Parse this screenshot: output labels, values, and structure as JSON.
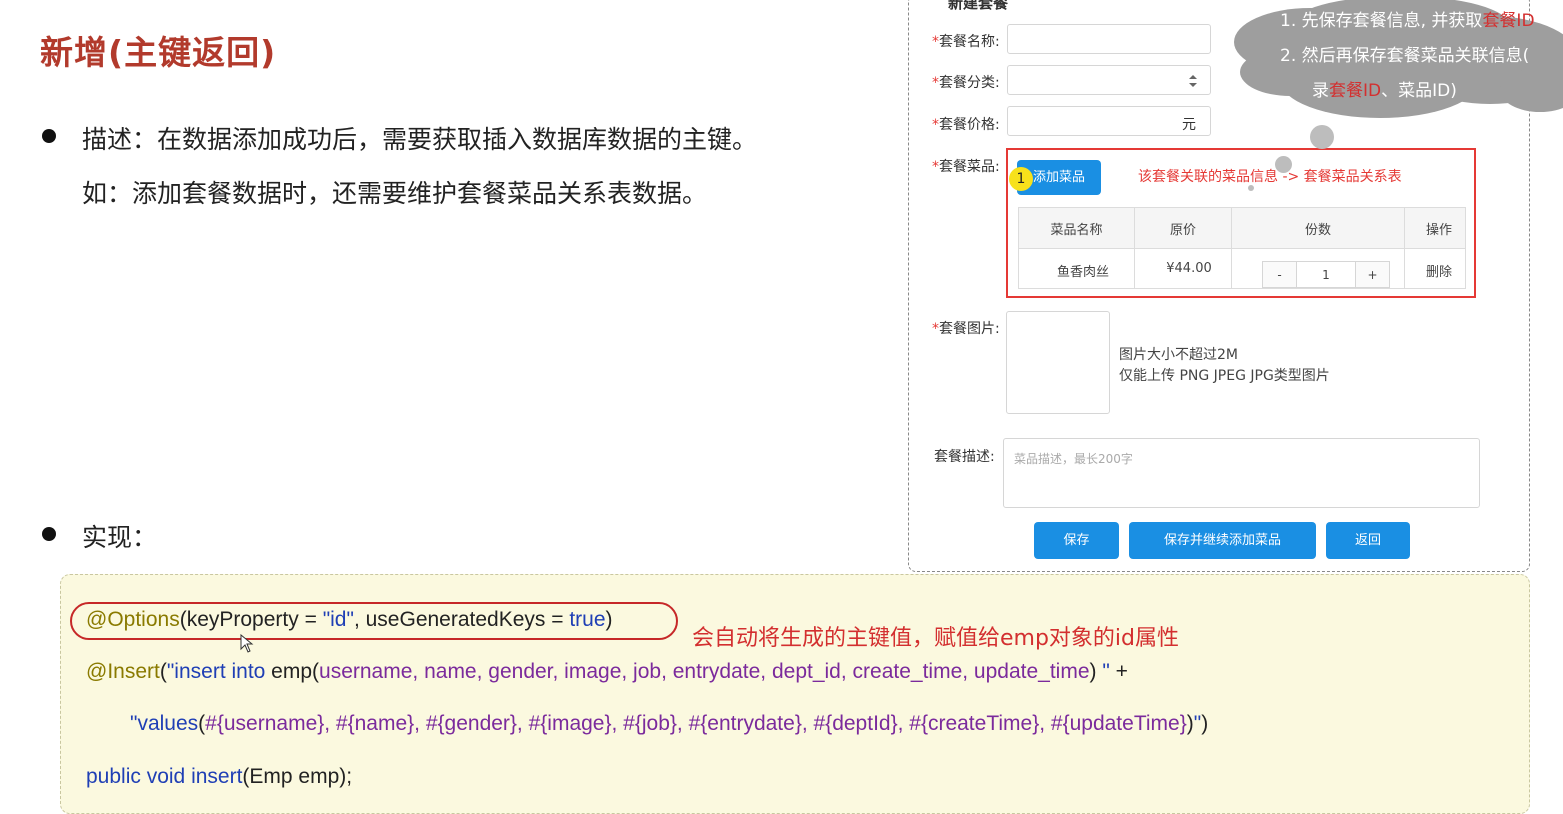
{
  "slide": {
    "title": "新增(主键返回)",
    "description_line1": "描述：在数据添加成功后，需要获取插入数据库数据的主键。",
    "description_line2": "如：添加套餐数据时，还需要维护套餐菜品关系表数据。",
    "implementation_label": "实现："
  },
  "form": {
    "panel_title": "新建套餐",
    "required_mark": "*",
    "name_label": "套餐名称:",
    "category_label": "套餐分类:",
    "price_label": "套餐价格:",
    "price_unit": "元",
    "dishes_label": "套餐菜品:",
    "add_dish_button": "添加菜品",
    "badge_number": "1",
    "relation_note": "该套餐关联的菜品信息 -> 套餐菜品关系表",
    "table": {
      "headers": [
        "菜品名称",
        "原价",
        "份数",
        "操作"
      ],
      "row": {
        "name": "鱼香肉丝",
        "price": "¥44.00",
        "minus": "-",
        "qty": "1",
        "plus": "+",
        "action": "删除"
      }
    },
    "image_label": "套餐图片:",
    "image_hint1": "图片大小不超过2M",
    "image_hint2": "仅能上传 PNG JPEG JPG类型图片",
    "desc_label": "套餐描述:",
    "desc_placeholder": "菜品描述，最长200字",
    "save_button": "保存",
    "save_continue_button": "保存并继续添加菜品",
    "back_button": "返回"
  },
  "cloud": {
    "line1_prefix": "1.   先保存套餐信息, 并获取",
    "line1_red": "套餐ID",
    "line2": "2.   然后再保存套餐菜品关联信息(",
    "line3_prefix": "录",
    "line3_red": "套餐ID",
    "line3_suffix": "、菜品ID)"
  },
  "code": {
    "l1_ann": "@Options",
    "l1_rest": "(keyProperty = ",
    "l1_str": "\"id\"",
    "l1_mid": ", useGeneratedKeys = ",
    "l1_kw": "true",
    "l1_end": ")",
    "l2_ann": "@Insert",
    "l2_a": "(",
    "l2_str1": "\"insert into",
    "l2_b": " emp(",
    "l2_cols": "username, name, gender, image, job, entrydate, dept_id, create_time, update_time",
    "l2_c": ") ",
    "l2_str2": "\"",
    "l2_d": " +",
    "l3_str": "\"values",
    "l3_a": "(",
    "l3_vals": "#{username}, #{name}, #{gender}, #{image}, #{job}, #{entrydate}, #{deptId}, #{createTime}, #{updateTime}",
    "l3_b": ")",
    "l3_str2": "\"",
    "l3_c": ")",
    "l4_kw": "public void",
    "l4_rest": " insert",
    "l4_args": "(Emp emp);",
    "note": "会自动将生成的主键值，赋值给emp对象的id属性"
  },
  "colors": {
    "title_red": "#b23a2c",
    "primary_blue": "#1a8fe3",
    "highlight_red": "#e53935",
    "code_bg": "#fbf9df",
    "cloud_gray": "#9e9e9e"
  }
}
